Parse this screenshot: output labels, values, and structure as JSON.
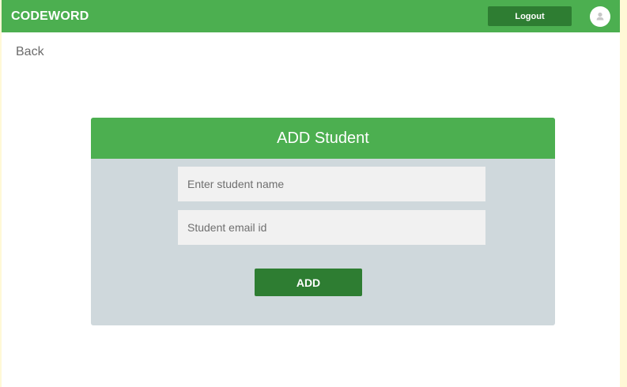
{
  "header": {
    "brand": "CODEWORD",
    "logout_label": "Logout",
    "avatar_icon": "user-avatar-icon"
  },
  "nav": {
    "back_label": "Back"
  },
  "form": {
    "title": "ADD Student",
    "name_placeholder": "Enter student name",
    "name_value": "",
    "email_placeholder": "Student email id",
    "email_value": "",
    "submit_label": "ADD"
  },
  "colors": {
    "primary": "#4caf50",
    "primary_dark": "#2e7d32",
    "card_body": "#cfd8dc",
    "input_bg": "#f1f1f1"
  }
}
